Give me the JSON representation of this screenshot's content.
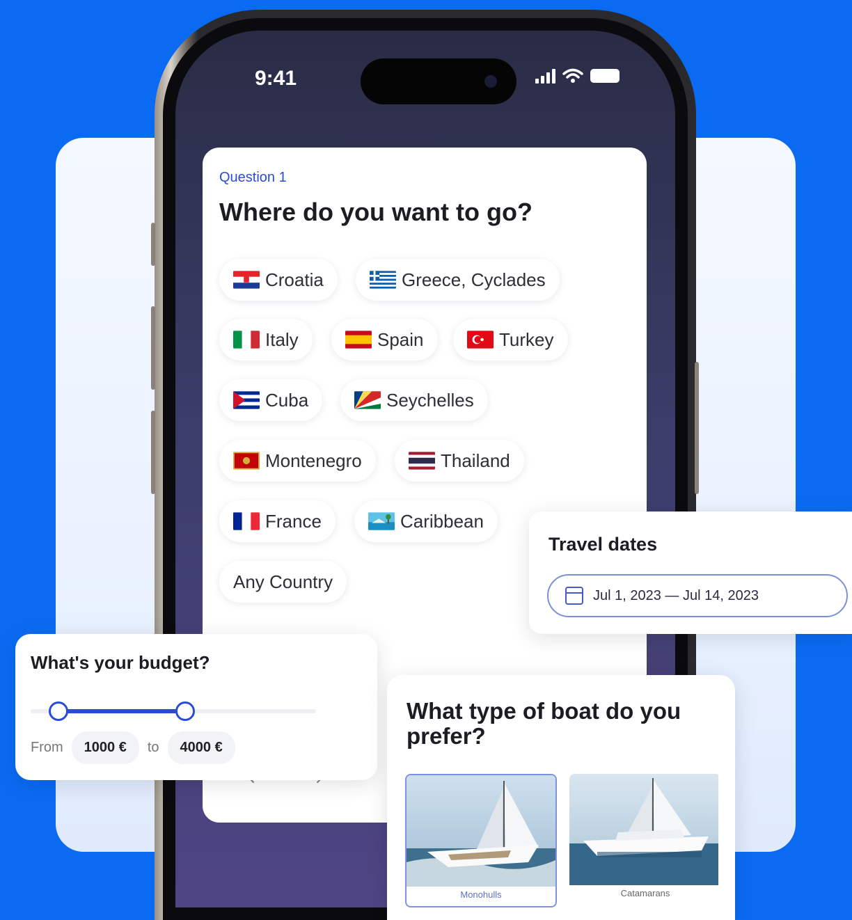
{
  "status_bar": {
    "time": "9:41"
  },
  "question": {
    "label": "Question 1",
    "title": "Where do you want to go?",
    "options": [
      {
        "label": "Croatia",
        "icon": "croatia-flag-icon"
      },
      {
        "label": "Greece, Cyclades",
        "icon": "greece-flag-icon"
      },
      {
        "label": "Italy",
        "icon": "italy-flag-icon"
      },
      {
        "label": "Spain",
        "icon": "spain-flag-icon"
      },
      {
        "label": "Turkey",
        "icon": "turkey-flag-icon"
      },
      {
        "label": "Cuba",
        "icon": "cuba-flag-icon"
      },
      {
        "label": "Seychelles",
        "icon": "seychelles-flag-icon"
      },
      {
        "label": "Montenegro",
        "icon": "montenegro-flag-icon"
      },
      {
        "label": "Thailand",
        "icon": "thailand-flag-icon"
      },
      {
        "label": "France",
        "icon": "france-flag-icon"
      },
      {
        "label": "Caribbean",
        "icon": "caribbean-icon"
      },
      {
        "label": "Any Country"
      }
    ]
  },
  "travel_dates": {
    "title": "Travel dates",
    "value": "Jul 1, 2023 — Jul 14, 2023"
  },
  "budget": {
    "title": "What's your budget?",
    "from_label": "From",
    "from_value": "1000 €",
    "to_label": "to",
    "to_value": "4000 €"
  },
  "boat_type": {
    "title": "What type of boat do you prefer?",
    "options": [
      {
        "label": "Monohulls",
        "selected": true
      },
      {
        "label": "Catamarans",
        "selected": false
      }
    ]
  },
  "colors": {
    "background": "#0a6bf2",
    "accent": "#2a4bd8"
  }
}
